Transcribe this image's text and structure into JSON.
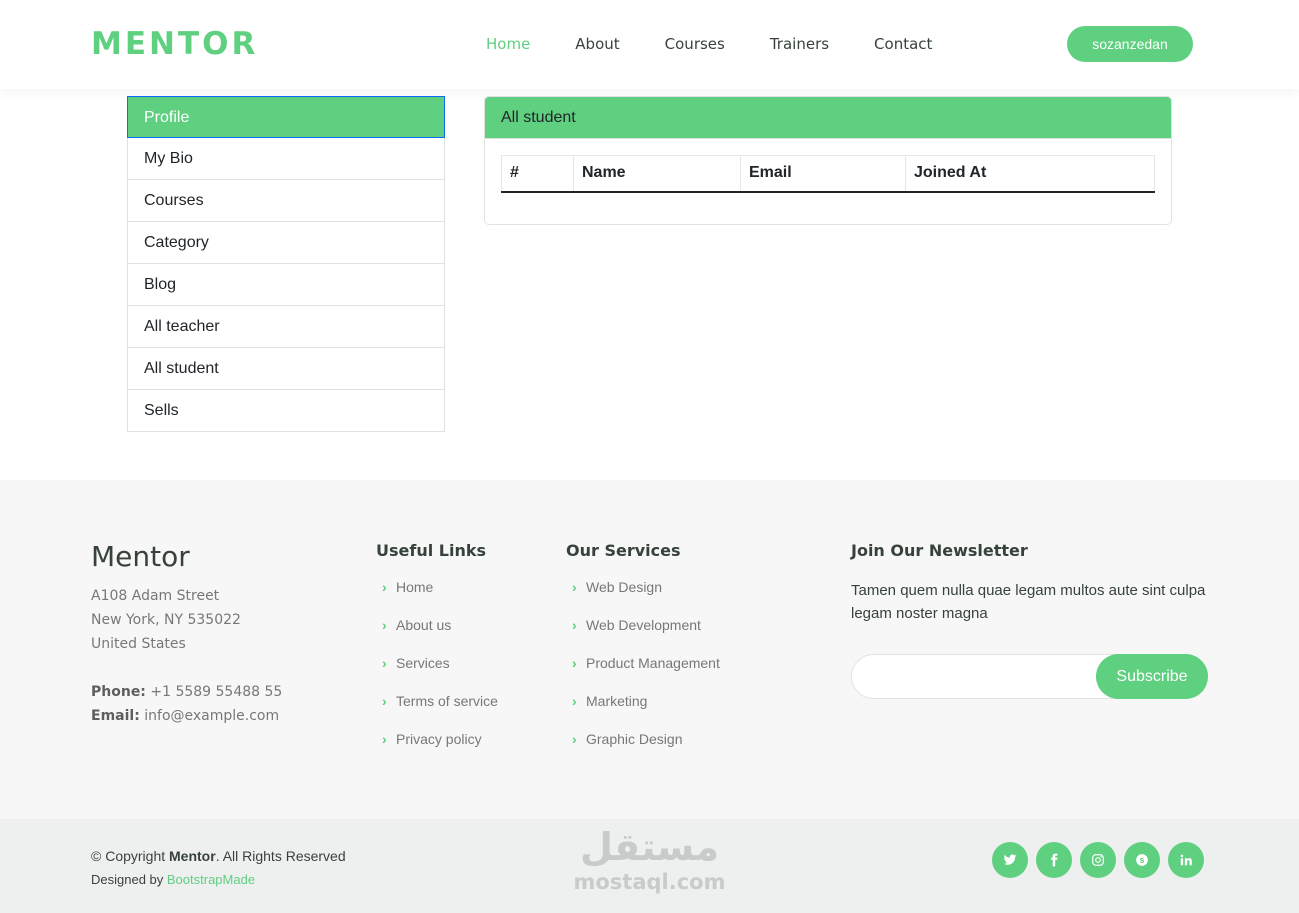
{
  "header": {
    "logo": "MENTOR",
    "nav": [
      "Home",
      "About",
      "Courses",
      "Trainers",
      "Contact"
    ],
    "active_nav": "Home",
    "user_button": "sozanzedan"
  },
  "sidebar": {
    "items": [
      "Profile",
      "My Bio",
      "Courses",
      "Category",
      "Blog",
      "All teacher",
      "All student",
      "Sells"
    ],
    "active": "Profile"
  },
  "main": {
    "card_title": "All student",
    "table": {
      "columns": [
        "#",
        "Name",
        "Email",
        "Joined At"
      ],
      "rows": []
    }
  },
  "footer": {
    "brand": "Mentor",
    "address": [
      "A108 Adam Street",
      "New York, NY 535022",
      "United States"
    ],
    "phone_label": "Phone:",
    "phone": "+1 5589 55488 55",
    "email_label": "Email:",
    "email": "info@example.com",
    "useful_links_title": "Useful Links",
    "useful_links": [
      "Home",
      "About us",
      "Services",
      "Terms of service",
      "Privacy policy"
    ],
    "services_title": "Our Services",
    "services": [
      "Web Design",
      "Web Development",
      "Product Management",
      "Marketing",
      "Graphic Design"
    ],
    "newsletter_title": "Join Our Newsletter",
    "newsletter_text": "Tamen quem nulla quae legam multos aute sint culpa legam noster magna",
    "subscribe_label": "Subscribe"
  },
  "bottom": {
    "copyright_prefix": "© Copyright ",
    "copyright_brand": "Mentor",
    "copyright_suffix": ". All Rights Reserved",
    "designed_by": "Designed by ",
    "designer": "BootstrapMade",
    "watermark_ar": "مستقل",
    "watermark_en": "mostaql.com"
  },
  "colors": {
    "accent": "#5fcf80",
    "text": "#37423b",
    "muted": "#777777"
  },
  "social_icons": [
    "twitter-icon",
    "facebook-icon",
    "instagram-icon",
    "skype-icon",
    "linkedin-icon"
  ]
}
